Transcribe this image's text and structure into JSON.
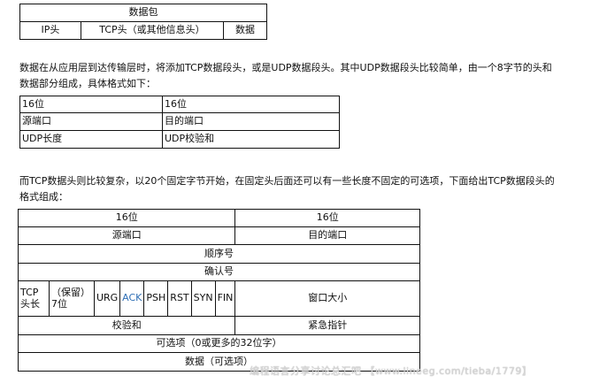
{
  "packet_table": {
    "title": "数据包",
    "cols": [
      "IP头",
      "TCP头（或其他信息头）",
      "数据"
    ]
  },
  "paragraph1": {
    "line1": "数据在从应用层到达传输层时，将添加TCP数据段头，或是UDP数据段头。其中UDP数据段头比较简单，由一个8字节的头和",
    "line2": "数据部分组成，具体格式如下："
  },
  "udp_table": {
    "rows": [
      [
        "16位",
        "16位"
      ],
      [
        "源端口",
        "目的端口"
      ],
      [
        "UDP长度",
        "UDP校验和"
      ]
    ]
  },
  "paragraph2": {
    "line1": "而TCP数据头则比较复杂，以20个固定字节开始，在固定头后面还可以有一些长度不固定的可选项，下面给出TCP数据段头的",
    "line2": "格式组成："
  },
  "tcp_table": {
    "bits_left": "16位",
    "bits_right": "16位",
    "src_port": "源端口",
    "dst_port": "目的端口",
    "seq": "顺序号",
    "ack_no": "确认号",
    "hdr_len_1": "TCP",
    "hdr_len_2": "头长",
    "reserved_1": "（保留）",
    "reserved_2": "7位",
    "flags": [
      "URG",
      "ACK",
      "PSH",
      "RST",
      "SYN",
      "FIN"
    ],
    "window": "窗口大小",
    "checksum": "校验和",
    "urgent": "紧急指针",
    "options": "可选项（0或更多的32位字）",
    "data": "数据（可选项）"
  },
  "colors": {
    "ack_flag": "#2f6fb5"
  },
  "watermark": "编程语言分享讨论总汇吧 【www.lineeg.com/tieba/1779】"
}
